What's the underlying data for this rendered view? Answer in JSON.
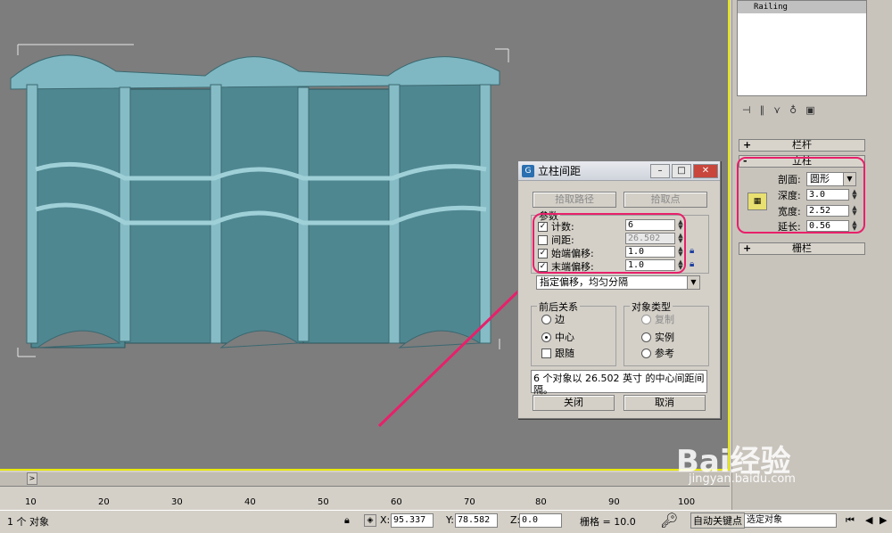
{
  "modifier_stack": {
    "selected": "Railing"
  },
  "panel": {
    "rollout_railing": "栏杆",
    "rollout_posts": "立柱",
    "rollout_fencing": "栅栏",
    "profile_label": "剖面:",
    "profile_value": "圆形",
    "depth_label": "深度:",
    "depth_value": "3.0",
    "width_label": "宽度:",
    "width_value": "2.52",
    "extension_label": "延长:",
    "extension_value": "0.56"
  },
  "dialog": {
    "title": "立柱间距",
    "pick_path": "拾取路径",
    "pick_points": "拾取点",
    "params_legend": "参数",
    "count_label": "计数:",
    "count_value": "6",
    "count_checked": true,
    "spacing_label": "间距:",
    "spacing_value": "26.502",
    "spacing_checked": false,
    "start_offset_label": "始端偏移:",
    "start_offset_value": "1.0",
    "start_checked": true,
    "end_offset_label": "末端偏移:",
    "end_offset_value": "1.0",
    "end_checked": true,
    "distribution": "指定偏移，均匀分隔",
    "context_legend": "前后关系",
    "edges": "边",
    "centers": "中心",
    "follow": "跟随",
    "type_legend": "对象类型",
    "copy": "复制",
    "instance": "实例",
    "reference": "参考",
    "info": "6 个对象以 26.502 英寸 的中心间距间隔。",
    "close": "关闭",
    "cancel": "取消"
  },
  "ruler": {
    "ticks": [
      "10",
      "20",
      "30",
      "40",
      "50",
      "60",
      "70",
      "80",
      "90",
      "100"
    ]
  },
  "status": {
    "selection": "1 个 对象",
    "x_label": "X:",
    "x_value": "95.337",
    "y_label": "Y:",
    "y_value": "78.582",
    "z_label": "Z:",
    "z_value": "0.0",
    "grid": "栅格 = 10.0",
    "autokey": "自动关键点",
    "selected_object": "选定对象"
  },
  "watermark": {
    "brand": "Bai经验",
    "url": "jingyan.baidu.com"
  },
  "colors": {
    "annotation": "#e8206a",
    "model": "#5e9aa6",
    "viewport": "#7d7d7d"
  }
}
